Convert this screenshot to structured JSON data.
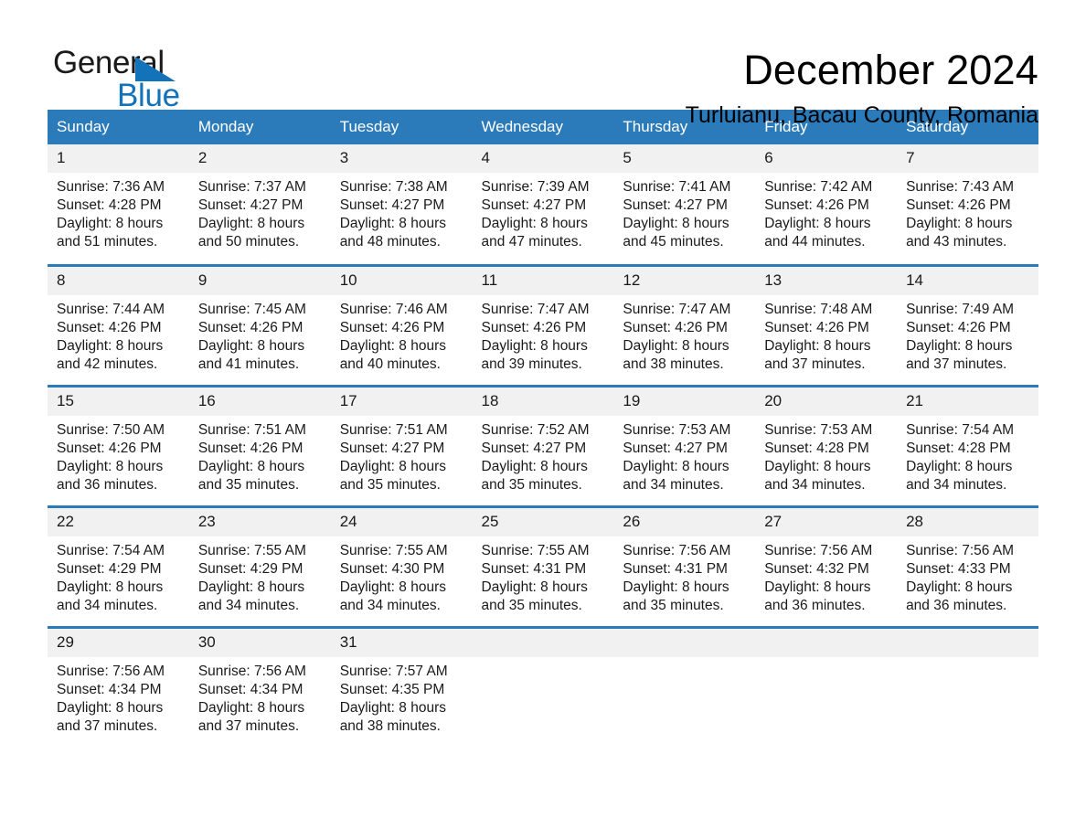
{
  "brand": {
    "name_top": "General",
    "name_bottom": "Blue",
    "accent_color": "#1273ba"
  },
  "header": {
    "month_title": "December 2024",
    "location": "Turluianu, Bacau County, Romania"
  },
  "calendar": {
    "header_bg": "#2b7bba",
    "daynum_bg": "#f1f1f1",
    "weekday_headers": [
      "Sunday",
      "Monday",
      "Tuesday",
      "Wednesday",
      "Thursday",
      "Friday",
      "Saturday"
    ],
    "weeks": [
      [
        {
          "day": "1",
          "sunrise": "Sunrise: 7:36 AM",
          "sunset": "Sunset: 4:28 PM",
          "daylight_line1": "Daylight: 8 hours",
          "daylight_line2": "and 51 minutes."
        },
        {
          "day": "2",
          "sunrise": "Sunrise: 7:37 AM",
          "sunset": "Sunset: 4:27 PM",
          "daylight_line1": "Daylight: 8 hours",
          "daylight_line2": "and 50 minutes."
        },
        {
          "day": "3",
          "sunrise": "Sunrise: 7:38 AM",
          "sunset": "Sunset: 4:27 PM",
          "daylight_line1": "Daylight: 8 hours",
          "daylight_line2": "and 48 minutes."
        },
        {
          "day": "4",
          "sunrise": "Sunrise: 7:39 AM",
          "sunset": "Sunset: 4:27 PM",
          "daylight_line1": "Daylight: 8 hours",
          "daylight_line2": "and 47 minutes."
        },
        {
          "day": "5",
          "sunrise": "Sunrise: 7:41 AM",
          "sunset": "Sunset: 4:27 PM",
          "daylight_line1": "Daylight: 8 hours",
          "daylight_line2": "and 45 minutes."
        },
        {
          "day": "6",
          "sunrise": "Sunrise: 7:42 AM",
          "sunset": "Sunset: 4:26 PM",
          "daylight_line1": "Daylight: 8 hours",
          "daylight_line2": "and 44 minutes."
        },
        {
          "day": "7",
          "sunrise": "Sunrise: 7:43 AM",
          "sunset": "Sunset: 4:26 PM",
          "daylight_line1": "Daylight: 8 hours",
          "daylight_line2": "and 43 minutes."
        }
      ],
      [
        {
          "day": "8",
          "sunrise": "Sunrise: 7:44 AM",
          "sunset": "Sunset: 4:26 PM",
          "daylight_line1": "Daylight: 8 hours",
          "daylight_line2": "and 42 minutes."
        },
        {
          "day": "9",
          "sunrise": "Sunrise: 7:45 AM",
          "sunset": "Sunset: 4:26 PM",
          "daylight_line1": "Daylight: 8 hours",
          "daylight_line2": "and 41 minutes."
        },
        {
          "day": "10",
          "sunrise": "Sunrise: 7:46 AM",
          "sunset": "Sunset: 4:26 PM",
          "daylight_line1": "Daylight: 8 hours",
          "daylight_line2": "and 40 minutes."
        },
        {
          "day": "11",
          "sunrise": "Sunrise: 7:47 AM",
          "sunset": "Sunset: 4:26 PM",
          "daylight_line1": "Daylight: 8 hours",
          "daylight_line2": "and 39 minutes."
        },
        {
          "day": "12",
          "sunrise": "Sunrise: 7:47 AM",
          "sunset": "Sunset: 4:26 PM",
          "daylight_line1": "Daylight: 8 hours",
          "daylight_line2": "and 38 minutes."
        },
        {
          "day": "13",
          "sunrise": "Sunrise: 7:48 AM",
          "sunset": "Sunset: 4:26 PM",
          "daylight_line1": "Daylight: 8 hours",
          "daylight_line2": "and 37 minutes."
        },
        {
          "day": "14",
          "sunrise": "Sunrise: 7:49 AM",
          "sunset": "Sunset: 4:26 PM",
          "daylight_line1": "Daylight: 8 hours",
          "daylight_line2": "and 37 minutes."
        }
      ],
      [
        {
          "day": "15",
          "sunrise": "Sunrise: 7:50 AM",
          "sunset": "Sunset: 4:26 PM",
          "daylight_line1": "Daylight: 8 hours",
          "daylight_line2": "and 36 minutes."
        },
        {
          "day": "16",
          "sunrise": "Sunrise: 7:51 AM",
          "sunset": "Sunset: 4:26 PM",
          "daylight_line1": "Daylight: 8 hours",
          "daylight_line2": "and 35 minutes."
        },
        {
          "day": "17",
          "sunrise": "Sunrise: 7:51 AM",
          "sunset": "Sunset: 4:27 PM",
          "daylight_line1": "Daylight: 8 hours",
          "daylight_line2": "and 35 minutes."
        },
        {
          "day": "18",
          "sunrise": "Sunrise: 7:52 AM",
          "sunset": "Sunset: 4:27 PM",
          "daylight_line1": "Daylight: 8 hours",
          "daylight_line2": "and 35 minutes."
        },
        {
          "day": "19",
          "sunrise": "Sunrise: 7:53 AM",
          "sunset": "Sunset: 4:27 PM",
          "daylight_line1": "Daylight: 8 hours",
          "daylight_line2": "and 34 minutes."
        },
        {
          "day": "20",
          "sunrise": "Sunrise: 7:53 AM",
          "sunset": "Sunset: 4:28 PM",
          "daylight_line1": "Daylight: 8 hours",
          "daylight_line2": "and 34 minutes."
        },
        {
          "day": "21",
          "sunrise": "Sunrise: 7:54 AM",
          "sunset": "Sunset: 4:28 PM",
          "daylight_line1": "Daylight: 8 hours",
          "daylight_line2": "and 34 minutes."
        }
      ],
      [
        {
          "day": "22",
          "sunrise": "Sunrise: 7:54 AM",
          "sunset": "Sunset: 4:29 PM",
          "daylight_line1": "Daylight: 8 hours",
          "daylight_line2": "and 34 minutes."
        },
        {
          "day": "23",
          "sunrise": "Sunrise: 7:55 AM",
          "sunset": "Sunset: 4:29 PM",
          "daylight_line1": "Daylight: 8 hours",
          "daylight_line2": "and 34 minutes."
        },
        {
          "day": "24",
          "sunrise": "Sunrise: 7:55 AM",
          "sunset": "Sunset: 4:30 PM",
          "daylight_line1": "Daylight: 8 hours",
          "daylight_line2": "and 34 minutes."
        },
        {
          "day": "25",
          "sunrise": "Sunrise: 7:55 AM",
          "sunset": "Sunset: 4:31 PM",
          "daylight_line1": "Daylight: 8 hours",
          "daylight_line2": "and 35 minutes."
        },
        {
          "day": "26",
          "sunrise": "Sunrise: 7:56 AM",
          "sunset": "Sunset: 4:31 PM",
          "daylight_line1": "Daylight: 8 hours",
          "daylight_line2": "and 35 minutes."
        },
        {
          "day": "27",
          "sunrise": "Sunrise: 7:56 AM",
          "sunset": "Sunset: 4:32 PM",
          "daylight_line1": "Daylight: 8 hours",
          "daylight_line2": "and 36 minutes."
        },
        {
          "day": "28",
          "sunrise": "Sunrise: 7:56 AM",
          "sunset": "Sunset: 4:33 PM",
          "daylight_line1": "Daylight: 8 hours",
          "daylight_line2": "and 36 minutes."
        }
      ],
      [
        {
          "day": "29",
          "sunrise": "Sunrise: 7:56 AM",
          "sunset": "Sunset: 4:34 PM",
          "daylight_line1": "Daylight: 8 hours",
          "daylight_line2": "and 37 minutes."
        },
        {
          "day": "30",
          "sunrise": "Sunrise: 7:56 AM",
          "sunset": "Sunset: 4:34 PM",
          "daylight_line1": "Daylight: 8 hours",
          "daylight_line2": "and 37 minutes."
        },
        {
          "day": "31",
          "sunrise": "Sunrise: 7:57 AM",
          "sunset": "Sunset: 4:35 PM",
          "daylight_line1": "Daylight: 8 hours",
          "daylight_line2": "and 38 minutes."
        },
        {
          "day": "",
          "sunrise": "",
          "sunset": "",
          "daylight_line1": "",
          "daylight_line2": ""
        },
        {
          "day": "",
          "sunrise": "",
          "sunset": "",
          "daylight_line1": "",
          "daylight_line2": ""
        },
        {
          "day": "",
          "sunrise": "",
          "sunset": "",
          "daylight_line1": "",
          "daylight_line2": ""
        },
        {
          "day": "",
          "sunrise": "",
          "sunset": "",
          "daylight_line1": "",
          "daylight_line2": ""
        }
      ]
    ]
  }
}
